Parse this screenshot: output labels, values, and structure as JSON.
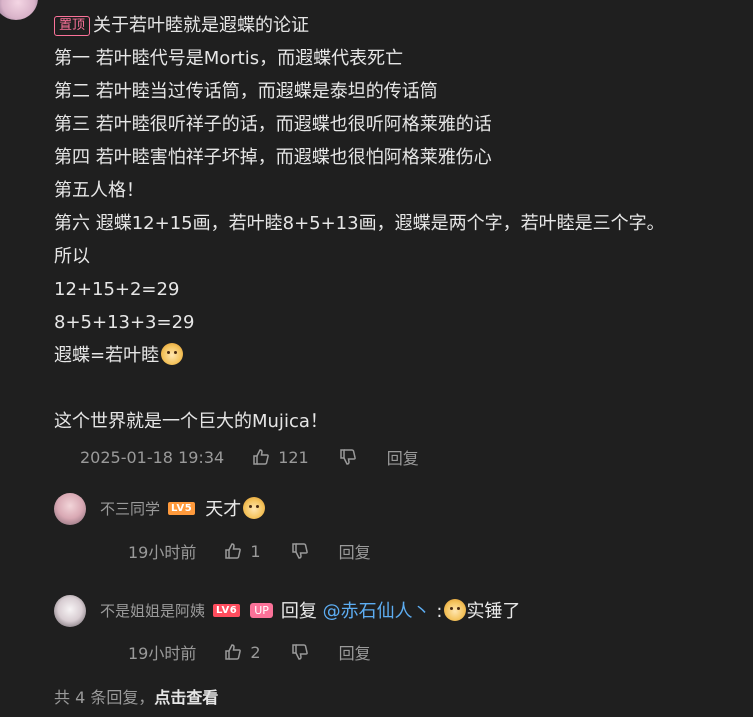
{
  "comment": {
    "pin_label": "置顶",
    "lines": [
      "关于若叶睦就是遐蝶的论证",
      "第一 若叶睦代号是Mortis，而遐蝶代表死亡",
      "第二 若叶睦当过传话筒，而遐蝶是泰坦的传话筒",
      "第三 若叶睦很听祥子的话，而遐蝶也很听阿格莱雅的话",
      "第四 若叶睦害怕祥子坏掉，而遐蝶也很怕阿格莱雅伤心",
      "第五人格！",
      "第六 遐蝶12+15画，若叶睦8+5+13画，遐蝶是两个字，若叶睦是三个字。",
      "所以",
      "12+15+2=29",
      "8+5+13+3=29",
      "遐蝶=若叶睦",
      "",
      "这个世界就是一个巨大的Mujica！"
    ],
    "emoji_name": "doge-emoji",
    "date": "2025-01-18 19:34",
    "likes": "121",
    "reply_label": "回复"
  },
  "replies": [
    {
      "username": "不三同学",
      "level": "LV5",
      "text": "天才",
      "emoji_name": "surprised-emoji",
      "time": "19小时前",
      "likes": "1",
      "reply_label": "回复"
    },
    {
      "username": "不是姐姐是阿姨",
      "level": "LV6",
      "up_tag": "UP",
      "text_prefix": "回复 ",
      "mention": "@赤石仙人丶",
      "text_sep": " :",
      "text_suffix": "实锤了",
      "emoji_name": "doge-emoji",
      "time": "19小时前",
      "likes": "2",
      "reply_label": "回复"
    }
  ],
  "more": {
    "prefix": "共 4 条回复，",
    "link": "点击查看"
  },
  "colors": {
    "background": "#1f1f1f",
    "pink_accent": "#fb7299",
    "mention_blue": "#5dadf2",
    "lv5": "#ff9a3c",
    "lv6": "#ff4d5e"
  }
}
